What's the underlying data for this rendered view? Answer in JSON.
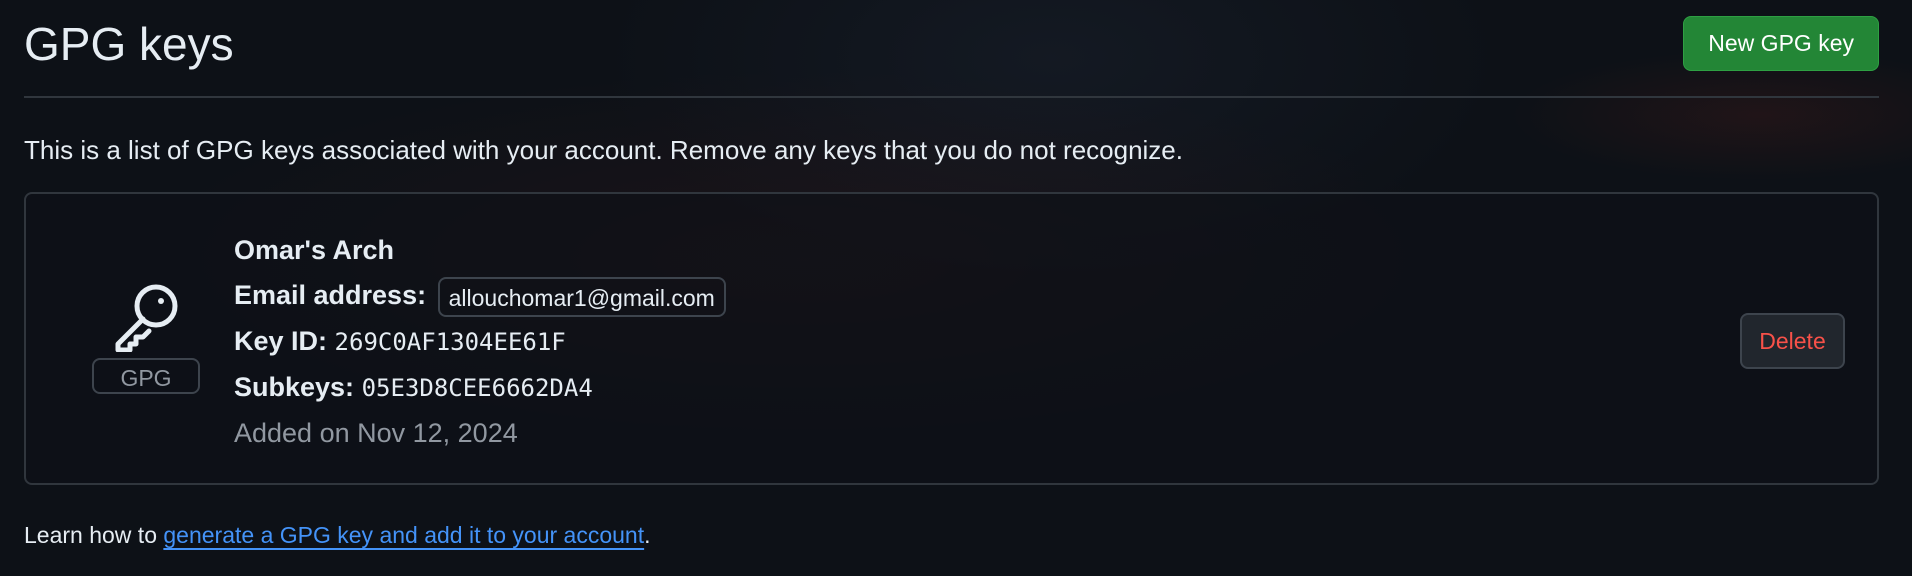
{
  "header": {
    "title": "GPG keys",
    "new_key_label": "New GPG key"
  },
  "description": "This is a list of GPG keys associated with your account. Remove any keys that you do not recognize.",
  "key": {
    "icon": "key-icon",
    "badge": "GPG",
    "title": "Omar's Arch",
    "email_label": "Email address:",
    "email": "allouchomar1@gmail.com",
    "key_id_label": "Key ID:",
    "key_id": "269C0AF1304EE61F",
    "subkeys_label": "Subkeys:",
    "subkeys": "05E3D8CEE6662DA4",
    "added": "Added on Nov 12, 2024",
    "delete_label": "Delete"
  },
  "footer": {
    "prefix": "Learn how to ",
    "link": "generate a GPG key and add it to your account",
    "suffix": "."
  },
  "colors": {
    "background": "#0d1117",
    "primary_button": "#238636",
    "danger_text": "#f85149",
    "link": "#4493f8"
  }
}
